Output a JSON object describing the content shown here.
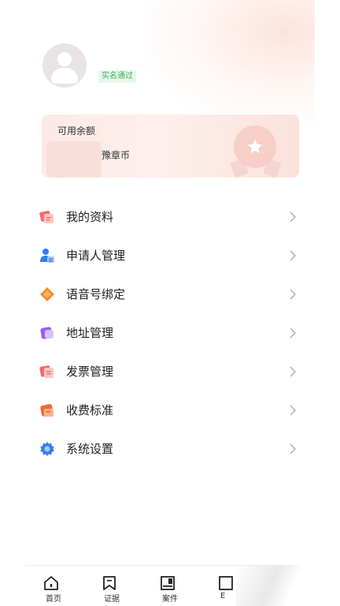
{
  "profile": {
    "verify_badge": "实名通过"
  },
  "balance": {
    "title": "可用余额",
    "unit": "豫章币"
  },
  "menu": {
    "items": [
      {
        "label": "我的资料",
        "icon": "profile-card-icon"
      },
      {
        "label": "申请人管理",
        "icon": "applicant-person-icon"
      },
      {
        "label": "语音号绑定",
        "icon": "voice-tag-icon"
      },
      {
        "label": "地址管理",
        "icon": "address-cube-icon"
      },
      {
        "label": "发票管理",
        "icon": "invoice-icon"
      },
      {
        "label": "收费标准",
        "icon": "fee-standard-icon"
      },
      {
        "label": "系统设置",
        "icon": "gear-icon"
      }
    ]
  },
  "nav": {
    "items": [
      {
        "label": "首页",
        "icon": "home-icon"
      },
      {
        "label": "证据",
        "icon": "evidence-bookmark-icon"
      },
      {
        "label": "案件",
        "icon": "case-folder-icon"
      },
      {
        "label": "E",
        "icon": "mine-icon"
      }
    ]
  },
  "colors": {
    "accent": "#f16a4e",
    "verify_green": "#3bb25a",
    "card_bg": "#fbe9e6"
  }
}
